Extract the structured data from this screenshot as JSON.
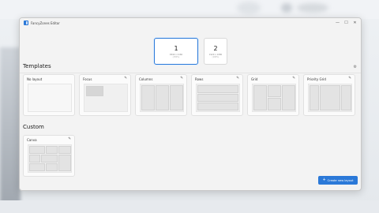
{
  "window": {
    "title": "FancyZones Editor",
    "minimize": "—",
    "maximize": "☐",
    "close": "✕"
  },
  "monitors": [
    {
      "number": "1",
      "line1": "3840 x 2160",
      "line2": "(150%)",
      "selected": true
    },
    {
      "number": "2",
      "line1": "1920 x 1080",
      "line2": "(100%)",
      "selected": false
    }
  ],
  "templates": {
    "heading": "Templates",
    "items": [
      {
        "label": "No layout",
        "editable": false
      },
      {
        "label": "Focus",
        "editable": true
      },
      {
        "label": "Columns",
        "editable": true
      },
      {
        "label": "Rows",
        "editable": true
      },
      {
        "label": "Grid",
        "editable": true
      },
      {
        "label": "Priority Grid",
        "editable": true
      }
    ]
  },
  "custom": {
    "heading": "Custom",
    "items": [
      {
        "label": "Canva",
        "editable": true
      }
    ]
  },
  "create_button": {
    "label": "Create new layout",
    "icon": "plus-icon"
  },
  "icons": {
    "edit": "pencil-icon",
    "settings": "gear-icon"
  },
  "colors": {
    "accent": "#2b79d8",
    "zone_fill": "#e3e3e3"
  }
}
